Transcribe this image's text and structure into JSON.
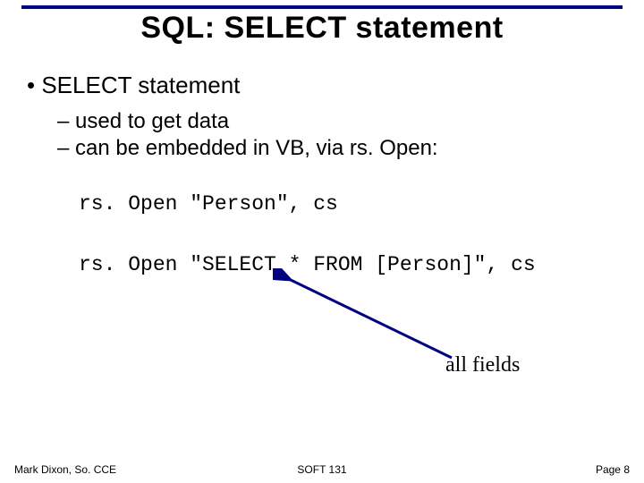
{
  "title": "SQL: SELECT statement",
  "bullets": {
    "main": "SELECT statement",
    "sub1": "used to get data",
    "sub2": "can be embedded in VB, via rs. Open:"
  },
  "code": {
    "line1": "rs. Open \"Person\", cs",
    "line2": "rs. Open \"SELECT * FROM [Person]\", cs"
  },
  "annotation": "all fields",
  "footer": {
    "left": "Mark Dixon, So. CCE",
    "center": "SOFT 131",
    "right": "Page 8"
  },
  "colors": {
    "rule": "#000080",
    "arrow": "#000080"
  }
}
